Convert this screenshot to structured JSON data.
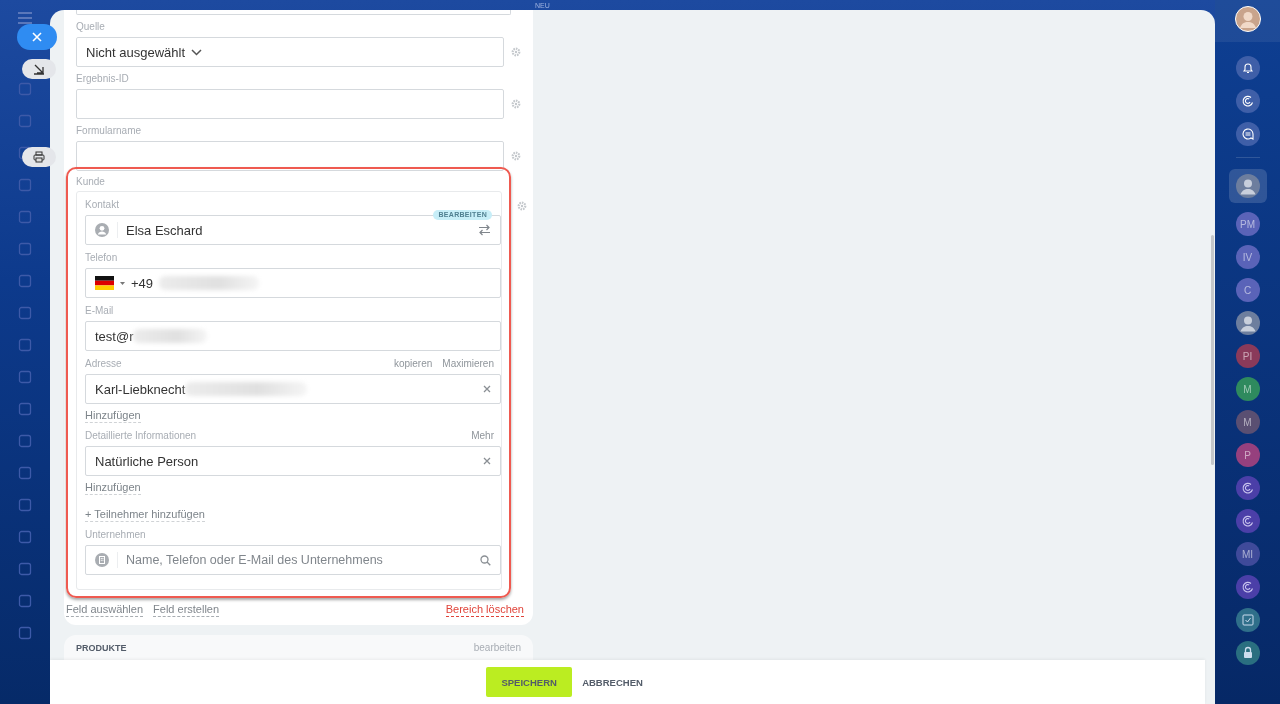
{
  "new_label": "NEU",
  "fields": [
    {
      "label": "Quelle",
      "kind": "select",
      "value": "Nicht ausgewählt"
    },
    {
      "label": "Ergebnis-ID",
      "kind": "text"
    },
    {
      "label": "Formularname",
      "kind": "text"
    }
  ],
  "customer": {
    "title": "Kunde",
    "contact": {
      "label": "Kontakt",
      "badge": "BEARBEITEN",
      "value": "Elsa Eschard"
    },
    "phone": {
      "label": "Telefon",
      "value": "+49"
    },
    "email": {
      "label": "E-Mail",
      "value": "test@r"
    },
    "address": {
      "label": "Adresse",
      "actions": [
        "kopieren",
        "Maximieren"
      ],
      "value": "Karl-Liebknecht",
      "add": "Hinzufügen"
    },
    "details": {
      "label": "Detaillierte Informationen",
      "action": "Mehr",
      "value": "Natürliche Person",
      "add": "Hinzufügen"
    },
    "add_participant": "+ Teilnehmer hinzufügen",
    "company": {
      "label": "Unternehmen",
      "placeholder": "Name, Telefon oder E-Mail des Unternehmens"
    }
  },
  "card_links": [
    {
      "label": "Feld auswählen",
      "kind": "normal"
    },
    {
      "label": "Feld erstellen",
      "kind": "normal"
    },
    {
      "label": "Bereich löschen",
      "kind": "danger"
    }
  ],
  "products": {
    "title": "PRODUKTE",
    "action": "bearbeiten"
  },
  "buttons": [
    {
      "label": "SPEICHERN",
      "kind": "primary"
    },
    {
      "label": "ABBRECHEN",
      "kind": "secondary"
    }
  ],
  "right_avatars": [
    {
      "kind": "photo"
    },
    {
      "kind": "initials",
      "text": "PM",
      "color": "#5a63b8"
    },
    {
      "kind": "initials",
      "text": "IV",
      "color": "#5a63b8"
    },
    {
      "kind": "initials",
      "text": "C",
      "color": "#5a63b8"
    },
    {
      "kind": "photo"
    },
    {
      "kind": "initials",
      "text": "PI",
      "color": "#8a3a5a"
    },
    {
      "kind": "initials",
      "text": "M",
      "color": "#2e8a5e"
    },
    {
      "kind": "initials",
      "text": "M",
      "color": "#5a4f72"
    },
    {
      "kind": "initials",
      "text": "P",
      "color": "#96407e"
    },
    {
      "kind": "channel",
      "color": "#4b3fa8"
    },
    {
      "kind": "channel",
      "color": "#4b3fa8"
    },
    {
      "kind": "initials",
      "text": "MI",
      "color": "#3f4a9a"
    },
    {
      "kind": "channel",
      "color": "#4b3fa8"
    }
  ]
}
